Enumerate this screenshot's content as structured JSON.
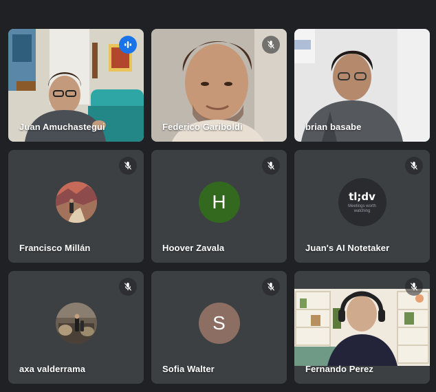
{
  "participants": [
    {
      "name": "Juan Amuchastegui",
      "state": "speaking",
      "view": "video"
    },
    {
      "name": "Federico Gariboldi",
      "state": "muted",
      "view": "video"
    },
    {
      "name": "brian basabe",
      "state": "unmuted",
      "view": "video"
    },
    {
      "name": "Francisco Millán",
      "state": "muted",
      "view": "photo-avatar"
    },
    {
      "name": "Hoover Zavala",
      "state": "muted",
      "view": "initial-avatar",
      "initial": "H",
      "avatar_color": "#33691e"
    },
    {
      "name": "Juan's AI Notetaker",
      "state": "unmuted",
      "view": "logo-avatar",
      "logo_text": "tl;dv",
      "logo_tagline": "Meetings worth watching"
    },
    {
      "name": "axa valderrama",
      "state": "muted",
      "view": "photo-avatar"
    },
    {
      "name": "Sofia Walter",
      "state": "muted",
      "view": "initial-avatar",
      "initial": "S",
      "avatar_color": "#8d6e63"
    },
    {
      "name": "Fernando Perez",
      "state": "muted",
      "view": "video"
    }
  ],
  "colors": {
    "background": "#202124",
    "tile": "#3c4043",
    "active_outline": "#8ab4f8",
    "speaking_badge": "#1a73e8"
  },
  "icons": {
    "muted": "mic-off-icon",
    "speaking": "audio-level-icon"
  }
}
